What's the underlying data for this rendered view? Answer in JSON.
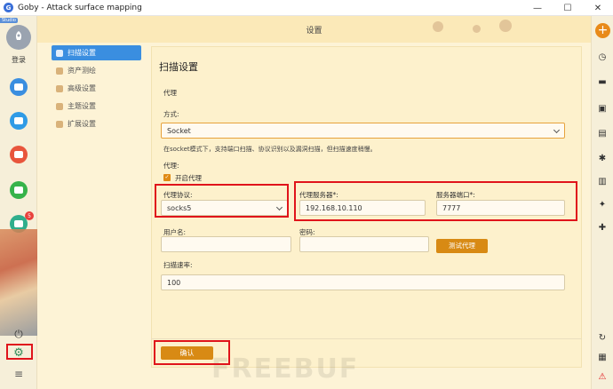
{
  "window": {
    "title": "Goby - Attack surface mapping",
    "minimize": "—",
    "maximize": "☐",
    "close": "✕"
  },
  "left_rail": {
    "studio_tag": "Studio",
    "login_label": "登录",
    "badge_count": "5"
  },
  "header": {
    "title": "设置"
  },
  "nav": {
    "items": [
      {
        "label": "扫描设置",
        "active": true
      },
      {
        "label": "资产测绘",
        "active": false
      },
      {
        "label": "高级设置",
        "active": false
      },
      {
        "label": "主题设置",
        "active": false
      },
      {
        "label": "扩展设置",
        "active": false
      }
    ]
  },
  "scan_settings": {
    "title": "扫描设置",
    "proxy_section": "代理",
    "mode_label": "方式:",
    "mode_value": "Socket",
    "mode_hint": "在socket模式下，支持端口扫描、协议识别以及漏洞扫描，但扫描速度稍慢。",
    "proxy_label": "代理:",
    "enable_proxy_label": "开启代理",
    "enable_proxy_checked": true,
    "protocol_label": "代理协议:",
    "protocol_value": "socks5",
    "server_label": "代理服务器*:",
    "server_value": "192.168.10.110",
    "port_label": "服务器端口*:",
    "port_value": "7777",
    "username_label": "用户名:",
    "username_value": "",
    "password_label": "密码:",
    "password_value": "",
    "test_proxy_button": "测试代理",
    "speed_label": "扫描速率:",
    "speed_value": "100",
    "confirm_button": "确认"
  },
  "watermark": "FREEBUF",
  "colors": {
    "accent_orange": "#d88a14",
    "active_blue": "#3a8ee0",
    "highlight_red": "#e0141b",
    "panel_bg": "#fdf1cc"
  }
}
